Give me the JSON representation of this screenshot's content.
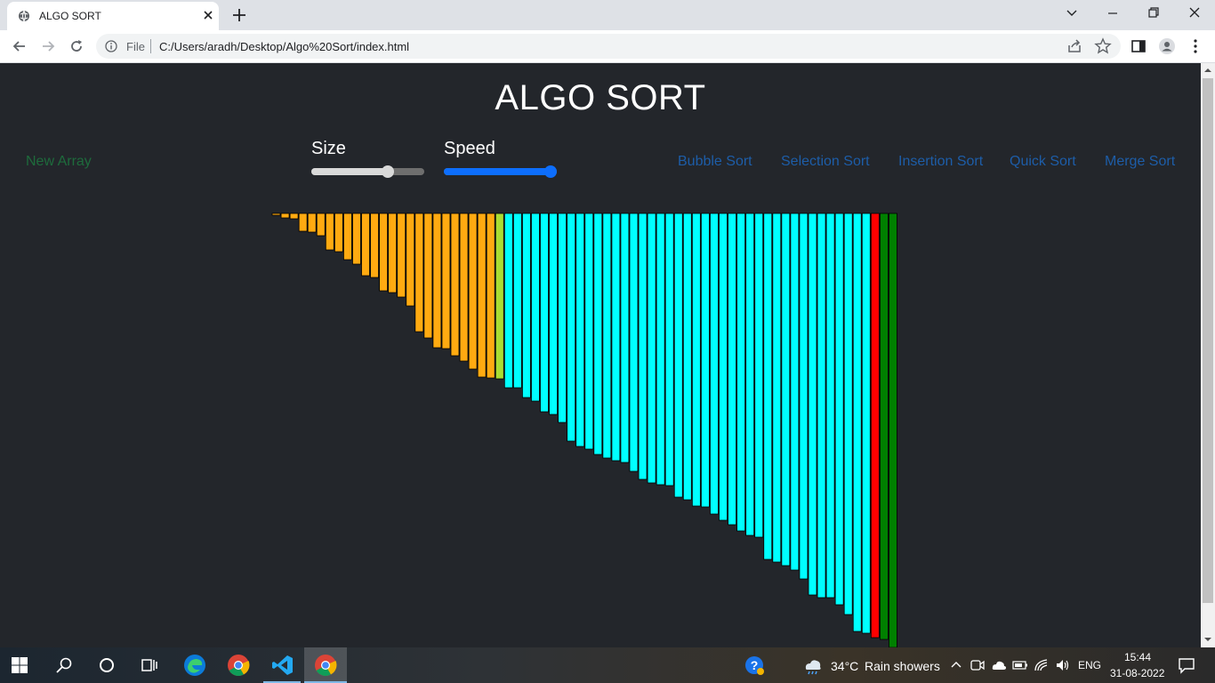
{
  "browser": {
    "tab_title": "ALGO SORT",
    "address_scheme_label": "File",
    "address_url": "C:/Users/aradh/Desktop/Algo%20Sort/index.html"
  },
  "page": {
    "title": "ALGO SORT",
    "new_array_label": "New Array",
    "size_label": "Size",
    "speed_label": "Speed",
    "size_value_fraction": 0.7,
    "speed_value_fraction": 1.0,
    "algorithms": [
      "Bubble Sort",
      "Selection Sort",
      "Insertion Sort",
      "Quick Sort",
      "Merge Sort"
    ],
    "colors": {
      "background": "#23262b",
      "unsorted": "#ffaa11",
      "sorted_run": "#00ffff",
      "transition": "#aadd33",
      "comparing": "#ff0000",
      "final": "#008000",
      "new_array": "#1e6b3c",
      "algo_buttons": "#1d5da8"
    }
  },
  "array_bars": {
    "values": [
      2,
      5,
      6,
      20,
      21,
      25,
      41,
      43,
      52,
      57,
      70,
      72,
      87,
      89,
      94,
      104,
      133,
      140,
      151,
      152,
      160,
      166,
      175,
      184,
      185,
      186,
      196,
      196,
      207,
      211,
      223,
      226,
      235,
      256,
      262,
      265,
      271,
      275,
      278,
      280,
      290,
      299,
      303,
      305,
      306,
      319,
      322,
      329,
      330,
      338,
      345,
      350,
      357,
      362,
      364,
      389,
      392,
      396,
      401,
      411,
      429,
      432,
      432,
      440,
      451,
      470,
      472,
      477,
      479,
      488
    ],
    "colors": [
      "#ffaa11",
      "#ffaa11",
      "#ffaa11",
      "#ffaa11",
      "#ffaa11",
      "#ffaa11",
      "#ffaa11",
      "#ffaa11",
      "#ffaa11",
      "#ffaa11",
      "#ffaa11",
      "#ffaa11",
      "#ffaa11",
      "#ffaa11",
      "#ffaa11",
      "#ffaa11",
      "#ffaa11",
      "#ffaa11",
      "#ffaa11",
      "#ffaa11",
      "#ffaa11",
      "#ffaa11",
      "#ffaa11",
      "#ffaa11",
      "#ffaa11",
      "#aadd33",
      "#00ffff",
      "#00ffff",
      "#00ffff",
      "#00ffff",
      "#00ffff",
      "#00ffff",
      "#00ffff",
      "#00ffff",
      "#00ffff",
      "#00ffff",
      "#00ffff",
      "#00ffff",
      "#00ffff",
      "#00ffff",
      "#00ffff",
      "#00ffff",
      "#00ffff",
      "#00ffff",
      "#00ffff",
      "#00ffff",
      "#00ffff",
      "#00ffff",
      "#00ffff",
      "#00ffff",
      "#00ffff",
      "#00ffff",
      "#00ffff",
      "#00ffff",
      "#00ffff",
      "#00ffff",
      "#00ffff",
      "#00ffff",
      "#00ffff",
      "#00ffff",
      "#00ffff",
      "#00ffff",
      "#00ffff",
      "#00ffff",
      "#00ffff",
      "#00ffff",
      "#00ffff",
      "#ff0000",
      "#008000",
      "#008000"
    ]
  },
  "taskbar": {
    "weather_temp": "34°C",
    "weather_desc": "Rain showers",
    "language": "ENG",
    "time": "15:44",
    "date": "31-08-2022"
  },
  "icons": [
    "globe-icon",
    "close-icon",
    "plus-icon",
    "chevron-down-icon",
    "minimize-icon",
    "restore-icon",
    "back-arrow-icon",
    "forward-arrow-icon",
    "reload-icon",
    "info-icon",
    "share-icon",
    "star-icon",
    "sidebar-icon",
    "profile-icon",
    "kebab-menu-icon",
    "windows-start-icon",
    "search-icon",
    "cortana-icon",
    "task-view-icon",
    "edge-icon",
    "chrome-icon",
    "vscode-icon",
    "help-icon",
    "weather-icon",
    "chevron-up-icon",
    "meet-icon",
    "cloud-icon",
    "battery-icon",
    "wifi-icon",
    "speaker-icon",
    "notification-icon"
  ]
}
